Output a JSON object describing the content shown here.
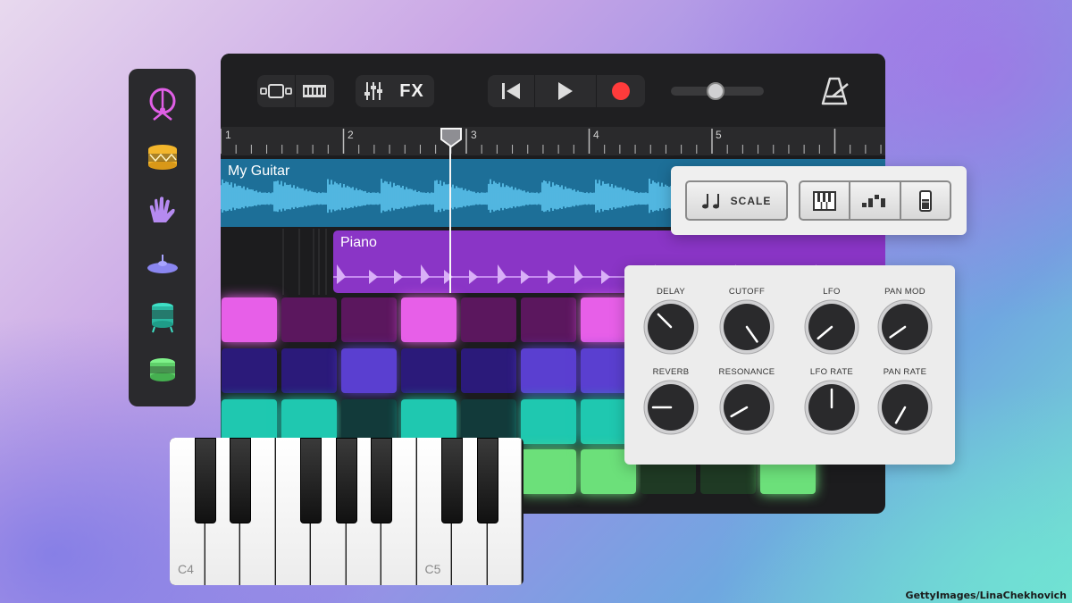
{
  "sidebar": {
    "items": [
      {
        "icon": "drum-kit-icon",
        "color": "#e05fe6"
      },
      {
        "icon": "snare-drum-icon",
        "color": "#f3b62c"
      },
      {
        "icon": "hand-clap-icon",
        "color": "#b58af0"
      },
      {
        "icon": "cymbal-icon",
        "color": "#8a86f0"
      },
      {
        "icon": "floor-tom-icon",
        "color": "#3fe0c6"
      },
      {
        "icon": "tom-drum-icon",
        "color": "#7ff28a"
      }
    ]
  },
  "toolbar": {
    "view_icons": [
      "tracks-view-icon",
      "grid-view-icon"
    ],
    "mixer_icon": "mixer-icon",
    "fx_label": "FX",
    "transport": [
      "rewind-icon",
      "play-icon",
      "record-icon"
    ],
    "volume_level": 0.5,
    "metronome_icon": "metronome-icon"
  },
  "ruler": {
    "bars": [
      "1",
      "2",
      "3",
      "4",
      "5"
    ]
  },
  "tracks": [
    {
      "name": "My Guitar",
      "color": "#1d6f98"
    },
    {
      "name": "Piano",
      "color": "#8a35c6"
    }
  ],
  "scale_panel": {
    "scale_label": "SCALE",
    "modes": [
      "keyboard-icon",
      "arpeggiator-icon",
      "strip-icon"
    ]
  },
  "knob_panel": {
    "knobs": [
      {
        "label": "DELAY",
        "value": -45
      },
      {
        "label": "CUTOFF",
        "value": 145
      },
      {
        "label": "LFO",
        "value": -130
      },
      {
        "label": "PAN MOD",
        "value": -125
      },
      {
        "label": "REVERB",
        "value": -90
      },
      {
        "label": "RESONANCE",
        "value": -120
      },
      {
        "label": "LFO RATE",
        "value": 0
      },
      {
        "label": "PAN RATE",
        "value": -150
      }
    ]
  },
  "keyboard": {
    "labels": [
      "C4",
      "C5"
    ]
  },
  "credit": "GettyImages/LinaChekhovich",
  "colors": {
    "pink_pad": "#e75fe8",
    "indigo_pad": "#5a3fd0",
    "teal_pad": "#1fc8b0",
    "green_pad": "#6ce07a"
  }
}
